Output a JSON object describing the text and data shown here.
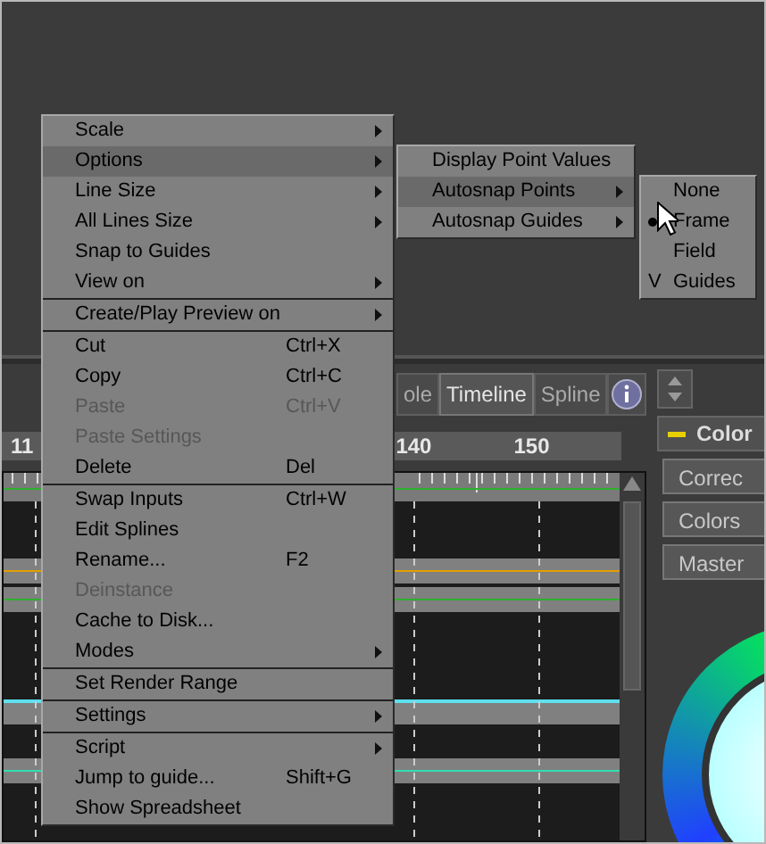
{
  "timeline_panel": {
    "tabs": [
      {
        "label": "ole",
        "selected": false
      },
      {
        "label": "Timeline",
        "selected": true
      },
      {
        "label": "Spline",
        "selected": false
      }
    ],
    "ruler_labels": [
      "11",
      "140",
      "150"
    ]
  },
  "color_panel": {
    "title": "Color",
    "buttons": [
      "Correc",
      "Colors",
      "Master"
    ]
  },
  "context_menu": {
    "sections": [
      [
        {
          "label": "Scale",
          "submenu": true,
          "disabled": false,
          "selected": false
        },
        {
          "label": "Options",
          "submenu": true,
          "disabled": false,
          "selected": true
        },
        {
          "label": "Line Size",
          "submenu": true,
          "disabled": false,
          "selected": false
        },
        {
          "label": "All Lines Size",
          "submenu": true,
          "disabled": false,
          "selected": false
        },
        {
          "label": "Snap to Guides",
          "submenu": false,
          "disabled": false,
          "selected": false
        },
        {
          "label": "View on",
          "submenu": true,
          "disabled": false,
          "selected": false
        }
      ],
      [
        {
          "label": "Create/Play Preview on",
          "submenu": true,
          "disabled": false,
          "selected": false
        }
      ],
      [
        {
          "label": "Cut",
          "shortcut": "Ctrl+X",
          "submenu": false,
          "disabled": false,
          "selected": false
        },
        {
          "label": "Copy",
          "shortcut": "Ctrl+C",
          "submenu": false,
          "disabled": false,
          "selected": false
        },
        {
          "label": "Paste",
          "shortcut": "Ctrl+V",
          "submenu": false,
          "disabled": true,
          "selected": false
        },
        {
          "label": "Paste Settings",
          "submenu": false,
          "disabled": true,
          "selected": false
        },
        {
          "label": "Delete",
          "shortcut": "Del",
          "submenu": false,
          "disabled": false,
          "selected": false
        }
      ],
      [
        {
          "label": "Swap Inputs",
          "shortcut": "Ctrl+W",
          "submenu": false,
          "disabled": false,
          "selected": false
        },
        {
          "label": "Edit Splines",
          "submenu": false,
          "disabled": false,
          "selected": false
        },
        {
          "label": "Rename...",
          "shortcut": "F2",
          "submenu": false,
          "disabled": false,
          "selected": false
        },
        {
          "label": "Deinstance",
          "submenu": false,
          "disabled": true,
          "selected": false
        },
        {
          "label": "Cache to Disk...",
          "submenu": false,
          "disabled": false,
          "selected": false
        },
        {
          "label": "Modes",
          "submenu": true,
          "disabled": false,
          "selected": false
        }
      ],
      [
        {
          "label": "Set Render Range",
          "submenu": false,
          "disabled": false,
          "selected": false
        }
      ],
      [
        {
          "label": "Settings",
          "submenu": true,
          "disabled": false,
          "selected": false
        }
      ],
      [
        {
          "label": "Script",
          "submenu": true,
          "disabled": false,
          "selected": false
        },
        {
          "label": "Jump to guide...",
          "shortcut": "Shift+G",
          "submenu": false,
          "disabled": false,
          "selected": false
        },
        {
          "label": "Show Spreadsheet",
          "submenu": false,
          "disabled": false,
          "selected": false
        }
      ]
    ]
  },
  "options_submenu": {
    "items": [
      {
        "label": "Display Point Values",
        "submenu": false,
        "selected": false
      },
      {
        "label": "Autosnap Points",
        "submenu": true,
        "selected": true
      },
      {
        "label": "Autosnap Guides",
        "submenu": true,
        "selected": false
      }
    ]
  },
  "autosnap_submenu": {
    "items": [
      {
        "label": "None",
        "kind": "radio",
        "selected": false
      },
      {
        "label": "Frame",
        "kind": "radio",
        "selected": true
      },
      {
        "label": "Field",
        "kind": "radio",
        "selected": false
      },
      {
        "label": "Guides",
        "kind": "check",
        "checked": true,
        "check_glyph": "V"
      }
    ]
  }
}
